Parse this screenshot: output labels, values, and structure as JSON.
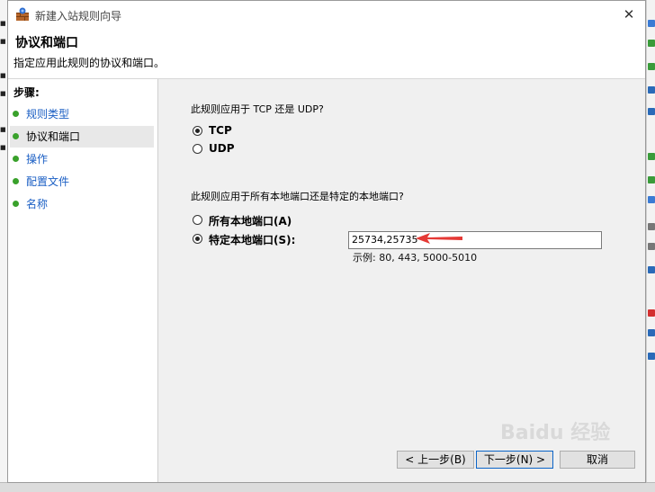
{
  "window": {
    "title": "新建入站规则向导",
    "close_glyph": "✕"
  },
  "header": {
    "title": "协议和端口",
    "description": "指定应用此规则的协议和端口。"
  },
  "sidebar": {
    "title": "步骤:",
    "steps": [
      {
        "label": "规则类型"
      },
      {
        "label": "协议和端口"
      },
      {
        "label": "操作"
      },
      {
        "label": "配置文件"
      },
      {
        "label": "名称"
      }
    ]
  },
  "protocol": {
    "question": "此规则应用于 TCP 还是 UDP?",
    "options": [
      {
        "label": "TCP",
        "selected": true
      },
      {
        "label": "UDP",
        "selected": false
      }
    ]
  },
  "ports": {
    "question": "此规则应用于所有本地端口还是特定的本地端口?",
    "options": [
      {
        "label": "所有本地端口(A)",
        "selected": false
      },
      {
        "label": "特定本地端口(S):",
        "selected": true
      }
    ],
    "value": "25734,25735",
    "example": "示例: 80, 443, 5000-5010"
  },
  "buttons": {
    "back": "< 上一步(B)",
    "next": "下一步(N) >",
    "cancel": "取消"
  },
  "watermark": "Baidu 经验",
  "colors": {
    "accent": "#1b5fc4",
    "step_dot": "#39a12b",
    "annotation_arrow": "#e53935"
  }
}
